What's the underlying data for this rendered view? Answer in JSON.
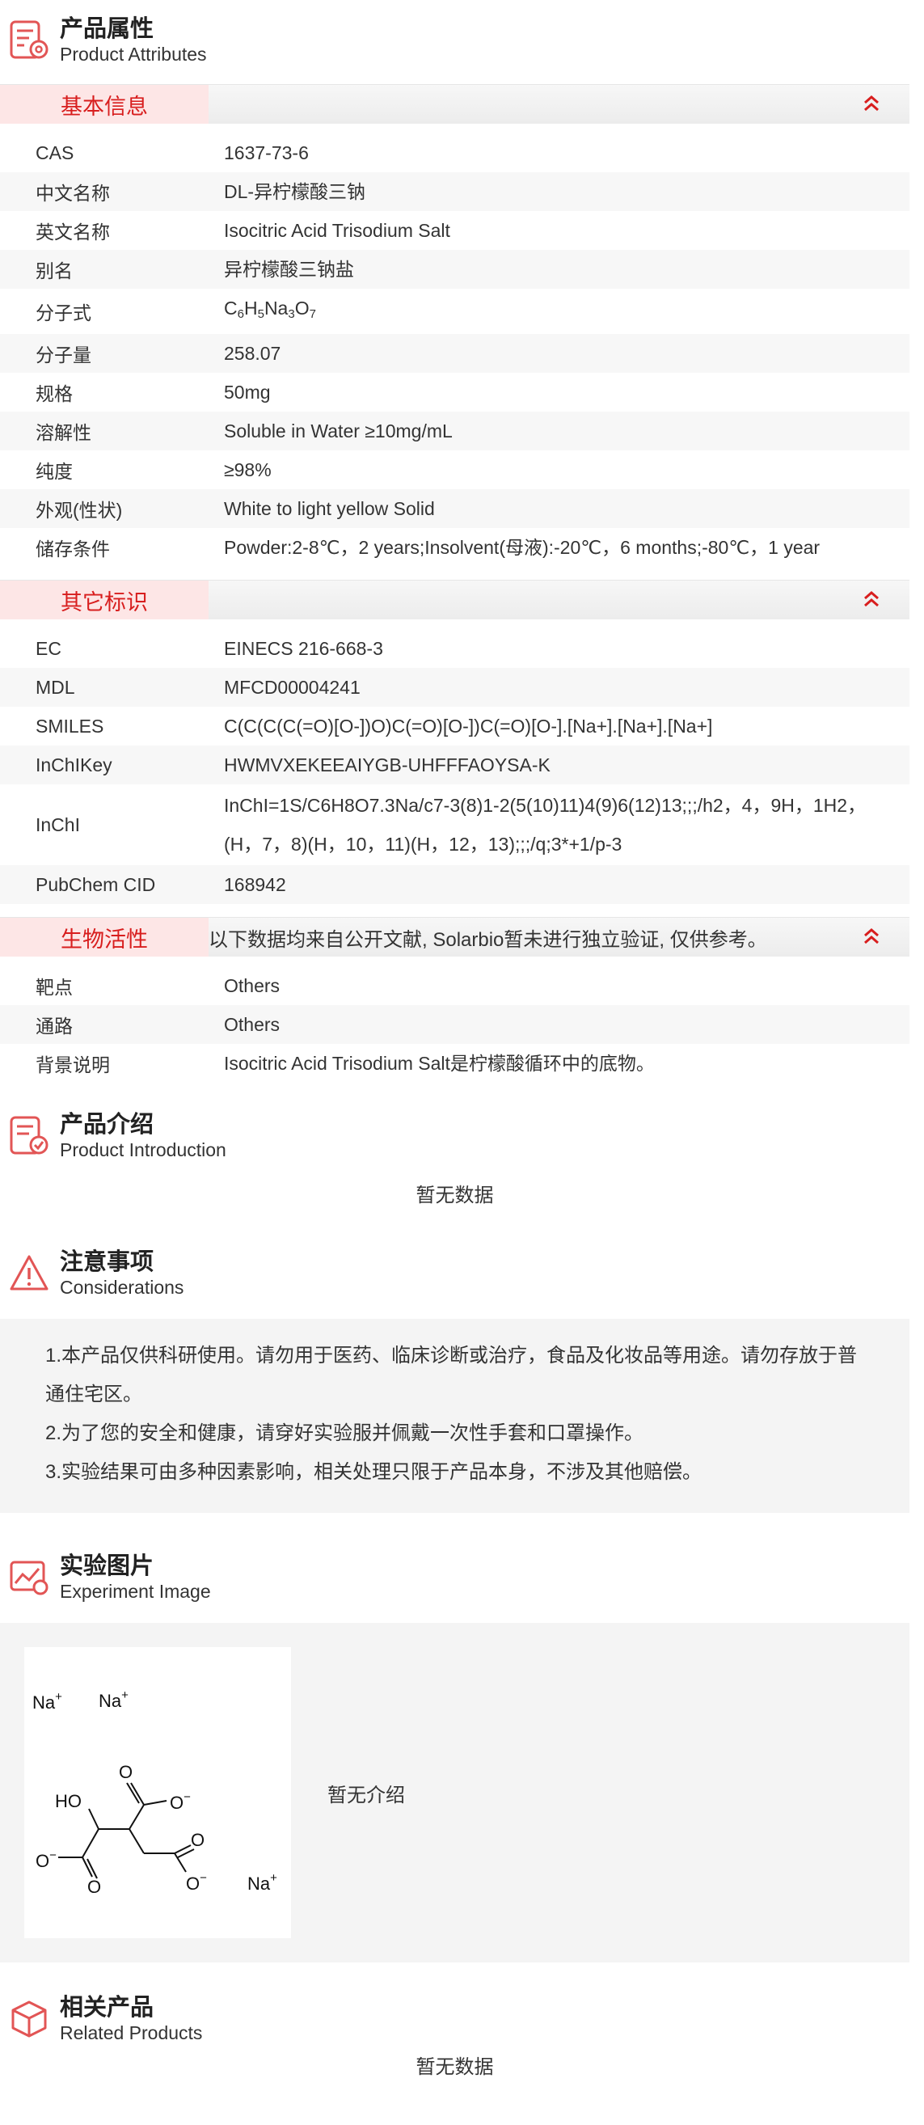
{
  "attributes": {
    "title_zh": "产品属性",
    "title_en": "Product Attributes"
  },
  "basic": {
    "tab": "基本信息",
    "rows": [
      {
        "k": "CAS",
        "v": "1637-73-6"
      },
      {
        "k": "中文名称",
        "v": "DL-异柠檬酸三钠"
      },
      {
        "k": "英文名称",
        "v": "Isocitric Acid Trisodium Salt"
      },
      {
        "k": "别名",
        "v": "异柠檬酸三钠盐"
      },
      {
        "k": "分子式",
        "v": ""
      },
      {
        "k": "分子量",
        "v": "258.07"
      },
      {
        "k": "规格",
        "v": "50mg"
      },
      {
        "k": "溶解性",
        "v": "Soluble in Water ≥10mg/mL"
      },
      {
        "k": "纯度",
        "v": "≥98%"
      },
      {
        "k": "外观(性状)",
        "v": "White to light yellow Solid"
      },
      {
        "k": "储存条件",
        "v": "Powder:2-8℃，2 years;Insolvent(母液):-20℃，6 months;-80℃，1 year"
      }
    ],
    "formula": {
      "c": "C",
      "c_n": "6",
      "h": "H",
      "h_n": "5",
      "na": "Na",
      "na_n": "3",
      "o": "O",
      "o_n": "7"
    }
  },
  "other": {
    "tab": "其它标识",
    "rows": [
      {
        "k": "EC",
        "v": "EINECS 216-668-3"
      },
      {
        "k": "MDL",
        "v": "MFCD00004241"
      },
      {
        "k": "SMILES",
        "v": "C(C(C(C(=O)[O-])O)C(=O)[O-])C(=O)[O-].[Na+].[Na+].[Na+]"
      },
      {
        "k": "InChIKey",
        "v": "HWMVXEKEEAIYGB-UHFFFAOYSA-K"
      },
      {
        "k": "InChI",
        "v": "InChI=1S/C6H8O7.3Na/c7-3(8)1-2(5(10)11)4(9)6(12)13;;;/h2，4，9H，1H2，(H，7，8)(H，10，11)(H，12，13);;;/q;3*+1/p-3"
      },
      {
        "k": "PubChem CID",
        "v": "168942"
      }
    ]
  },
  "bio": {
    "tab": "生物活性",
    "note": "以下数据均来自公开文献, Solarbio暂未进行独立验证, 仅供参考。",
    "rows": [
      {
        "k": "靶点",
        "v": "Others"
      },
      {
        "k": "通路",
        "v": "Others"
      },
      {
        "k": "背景说明",
        "v": "Isocitric Acid Trisodium Salt是柠檬酸循环中的底物。"
      }
    ]
  },
  "intro": {
    "title_zh": "产品介绍",
    "title_en": "Product Introduction",
    "empty": "暂无数据"
  },
  "consider": {
    "title_zh": "注意事项",
    "title_en": "Considerations",
    "items": [
      "1.本产品仅供科研使用。请勿用于医药、临床诊断或治疗，食品及化妆品等用途。请勿存放于普通住宅区。",
      "2.为了您的安全和健康，请穿好实验服并佩戴一次性手套和口罩操作。",
      "3.实验结果可由多种因素影响，相关处理只限于产品本身，不涉及其他赔偿。"
    ]
  },
  "experiment": {
    "title_zh": "实验图片",
    "title_en": "Experiment Image",
    "caption": "暂无介绍",
    "structure": {
      "na1": "Na",
      "na2": "Na",
      "na3": "Na",
      "plus": "+",
      "minus": "−",
      "ho": "HO",
      "o": "O"
    }
  },
  "related": {
    "title_zh": "相关产品",
    "title_en": "Related Products",
    "empty": "暂无数据"
  },
  "colors": {
    "accent": "#d81e1e",
    "tab_bg": "#fde6e6",
    "row_alt": "#f7f7f7",
    "box_bg": "#f4f4f4"
  },
  "icons": {
    "attributes": "document-gear-icon",
    "intro": "document-check-icon",
    "consider": "warning-triangle-icon",
    "experiment": "image-chart-icon",
    "related": "cube-icon",
    "collapse": "double-chevron-up-icon"
  }
}
